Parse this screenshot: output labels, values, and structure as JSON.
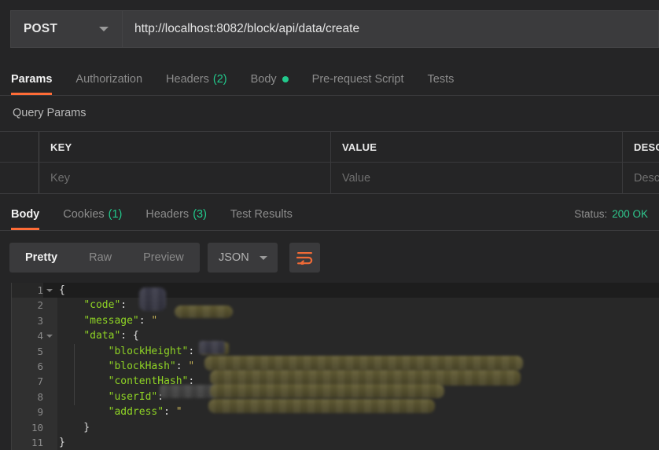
{
  "request": {
    "method": "POST",
    "url": "http://localhost:8082/block/api/data/create",
    "tabs": [
      {
        "label": "Params",
        "count": null,
        "dot": false,
        "active": true
      },
      {
        "label": "Authorization",
        "count": null,
        "dot": false,
        "active": false
      },
      {
        "label": "Headers",
        "count": "(2)",
        "dot": false,
        "active": false
      },
      {
        "label": "Body",
        "count": null,
        "dot": true,
        "active": false
      },
      {
        "label": "Pre-request Script",
        "count": null,
        "dot": false,
        "active": false
      },
      {
        "label": "Tests",
        "count": null,
        "dot": false,
        "active": false
      }
    ]
  },
  "query_params": {
    "section_title": "Query Params",
    "headers": [
      "KEY",
      "VALUE",
      "DESCR"
    ],
    "placeholders": [
      "Key",
      "Value",
      "Desc"
    ]
  },
  "response": {
    "tabs": [
      {
        "label": "Body",
        "count": null,
        "active": true
      },
      {
        "label": "Cookies",
        "count": "(1)",
        "active": false
      },
      {
        "label": "Headers",
        "count": "(3)",
        "active": false
      },
      {
        "label": "Test Results",
        "count": null,
        "active": false
      }
    ],
    "status_label": "Status:",
    "status_value": "200 OK",
    "view_modes": [
      {
        "label": "Pretty",
        "active": true
      },
      {
        "label": "Raw",
        "active": false
      },
      {
        "label": "Preview",
        "active": false
      }
    ],
    "format": "JSON",
    "wrap_icon": "word-wrap-icon"
  },
  "body_code": {
    "lines": [
      {
        "num": "1",
        "fold": true,
        "indent": 0,
        "text": "{",
        "type": "punc"
      },
      {
        "num": "2",
        "fold": false,
        "indent": 1,
        "key": "\"code\"",
        "sep": ":",
        "type": "kv"
      },
      {
        "num": "3",
        "fold": false,
        "indent": 1,
        "key": "\"message\"",
        "sep": ":",
        "type": "kv",
        "quoted": true
      },
      {
        "num": "4",
        "fold": true,
        "indent": 1,
        "key": "\"data\"",
        "sep": ": {",
        "type": "kv-open"
      },
      {
        "num": "5",
        "fold": false,
        "indent": 2,
        "key": "\"blockHeight\"",
        "sep": ":",
        "type": "kv"
      },
      {
        "num": "6",
        "fold": false,
        "indent": 2,
        "key": "\"blockHash\"",
        "sep": ":",
        "type": "kv",
        "quoted": true
      },
      {
        "num": "7",
        "fold": false,
        "indent": 2,
        "key": "\"contentHash\"",
        "sep": ":",
        "type": "kv"
      },
      {
        "num": "8",
        "fold": false,
        "indent": 2,
        "key": "\"userId\"",
        "sep": ":",
        "type": "kv"
      },
      {
        "num": "9",
        "fold": false,
        "indent": 2,
        "key": "\"address\"",
        "sep": ":",
        "type": "kv",
        "quoted": true
      },
      {
        "num": "10",
        "fold": false,
        "indent": 1,
        "text": "}",
        "type": "punc"
      },
      {
        "num": "11",
        "fold": false,
        "indent": 0,
        "text": "}",
        "type": "punc"
      }
    ],
    "redacted_note": "values redacted"
  },
  "colors": {
    "accent": "#ff6c37",
    "success": "#22c98c",
    "json_key": "#8fd425",
    "bg": "#252526",
    "editor_bg": "#282828"
  }
}
